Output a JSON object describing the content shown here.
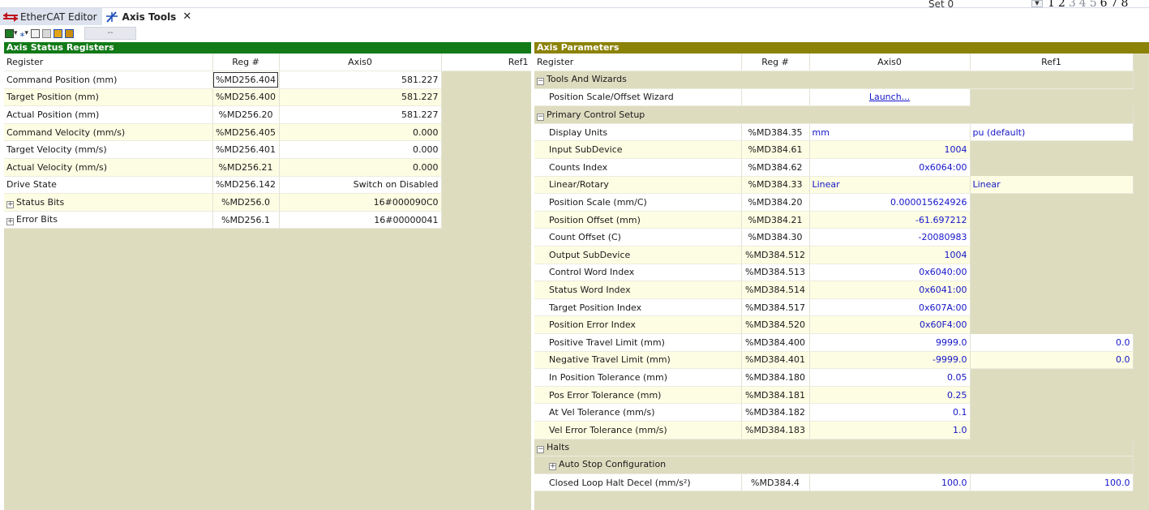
{
  "tabs": [
    {
      "label": "EtherCAT Editor",
      "icon": "ethercat-icon",
      "active": false
    },
    {
      "label": "Axis Tools",
      "icon": "axis-tools-icon",
      "active": true,
      "close": "✕"
    }
  ],
  "set_selector": {
    "label": "Set 0",
    "dropdown_glyph": "▼"
  },
  "pages": [
    {
      "label": "1",
      "state": "bold"
    },
    {
      "label": "2",
      "state": "bold"
    },
    {
      "label": "3",
      "state": "dim"
    },
    {
      "label": "4",
      "state": "dim"
    },
    {
      "label": "5",
      "state": "dim"
    },
    {
      "label": "6",
      "state": "bold"
    },
    {
      "label": "7",
      "state": "bold"
    },
    {
      "label": "8",
      "state": "bold"
    }
  ],
  "toolbar": {
    "field_value": "--"
  },
  "left_panel": {
    "title": "Axis Status Registers",
    "columns": [
      "Register",
      "Reg #",
      "Axis0",
      "Ref1"
    ],
    "rows": [
      {
        "register": "Command Position (mm)",
        "reg": "%MD256.404",
        "axis0": "581.227",
        "ref1": ""
      },
      {
        "register": "Target Position (mm)",
        "reg": "%MD256.400",
        "axis0": "581.227",
        "ref1": ""
      },
      {
        "register": "Actual Position (mm)",
        "reg": "%MD256.20",
        "axis0": "581.227",
        "ref1": ""
      },
      {
        "register": "Command Velocity (mm/s)",
        "reg": "%MD256.405",
        "axis0": "0.000",
        "ref1": ""
      },
      {
        "register": "Target Velocity (mm/s)",
        "reg": "%MD256.401",
        "axis0": "0.000",
        "ref1": ""
      },
      {
        "register": "Actual Velocity (mm/s)",
        "reg": "%MD256.21",
        "axis0": "0.000",
        "ref1": ""
      },
      {
        "register": "Drive State",
        "reg": "%MD256.142",
        "axis0": "Switch on Disabled",
        "ref1": ""
      },
      {
        "register": "Status Bits",
        "reg": "%MD256.0",
        "axis0": "16#000090C0",
        "ref1": "",
        "expander": "+"
      },
      {
        "register": "Error Bits",
        "reg": "%MD256.1",
        "axis0": "16#00000041",
        "ref1": "",
        "expander": "+"
      }
    ]
  },
  "right_panel": {
    "title": "Axis Parameters",
    "columns": [
      "Register",
      "Reg #",
      "Axis0",
      "Ref1"
    ],
    "sections": {
      "tools": {
        "label": "Tools And Wizards",
        "expander": "−"
      },
      "primary": {
        "label": "Primary Control Setup",
        "expander": "−"
      },
      "halts": {
        "label": "Halts",
        "expander": "−"
      }
    },
    "wizard_row": {
      "register": "Position Scale/Offset Wizard",
      "reg": "",
      "axis0": "Launch...",
      "ref1": ""
    },
    "primary_rows": [
      {
        "register": "Display Units",
        "reg": "%MD384.35",
        "axis0": "mm",
        "ref1": "pu (default)"
      },
      {
        "register": "Input SubDevice",
        "reg": "%MD384.61",
        "axis0": "1004",
        "ref1": ""
      },
      {
        "register": "Counts Index",
        "reg": "%MD384.62",
        "axis0": "0x6064:00",
        "ref1": ""
      },
      {
        "register": "Linear/Rotary",
        "reg": "%MD384.33",
        "axis0": "Linear",
        "ref1": "Linear"
      },
      {
        "register": "Position Scale (mm/C)",
        "reg": "%MD384.20",
        "axis0": "0.000015624926",
        "ref1": ""
      },
      {
        "register": "Position Offset (mm)",
        "reg": "%MD384.21",
        "axis0": "-61.697212",
        "ref1": ""
      },
      {
        "register": "Count Offset (C)",
        "reg": "%MD384.30",
        "axis0": "-20080983",
        "ref1": ""
      },
      {
        "register": "Output SubDevice",
        "reg": "%MD384.512",
        "axis0": "1004",
        "ref1": ""
      },
      {
        "register": "Control Word Index",
        "reg": "%MD384.513",
        "axis0": "0x6040:00",
        "ref1": ""
      },
      {
        "register": "Status Word Index",
        "reg": "%MD384.514",
        "axis0": "0x6041:00",
        "ref1": ""
      },
      {
        "register": "Target Position Index",
        "reg": "%MD384.517",
        "axis0": "0x607A:00",
        "ref1": ""
      },
      {
        "register": "Position Error Index",
        "reg": "%MD384.520",
        "axis0": "0x60F4:00",
        "ref1": ""
      },
      {
        "register": "Positive Travel Limit (mm)",
        "reg": "%MD384.400",
        "axis0": "9999.0",
        "ref1": "0.0"
      },
      {
        "register": "Negative Travel Limit (mm)",
        "reg": "%MD384.401",
        "axis0": "-9999.0",
        "ref1": "0.0"
      },
      {
        "register": "In Position Tolerance (mm)",
        "reg": "%MD384.180",
        "axis0": "0.05",
        "ref1": ""
      },
      {
        "register": "Pos Error Tolerance (mm)",
        "reg": "%MD384.181",
        "axis0": "0.25",
        "ref1": ""
      },
      {
        "register": "At Vel Tolerance (mm/s)",
        "reg": "%MD384.182",
        "axis0": "0.1",
        "ref1": ""
      },
      {
        "register": "Vel Error Tolerance (mm/s)",
        "reg": "%MD384.183",
        "axis0": "1.0",
        "ref1": ""
      }
    ],
    "auto_stop": {
      "label": "Auto Stop Configuration",
      "expander": "+"
    },
    "halt_row": {
      "register": "Closed Loop Halt Decel (mm/s²)",
      "reg": "%MD384.4",
      "axis0": "100.0",
      "ref1": "100.0"
    }
  }
}
